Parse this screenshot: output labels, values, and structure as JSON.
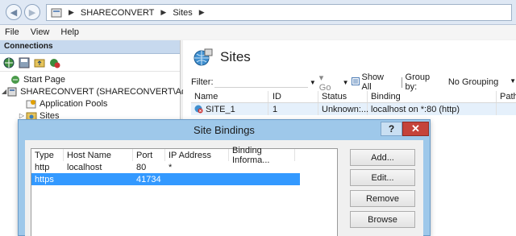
{
  "address": {
    "crumbs": [
      "SHARECONVERT",
      "Sites"
    ],
    "separator": "▶"
  },
  "menu": [
    "File",
    "View",
    "Help"
  ],
  "connections": {
    "header": "Connections",
    "tree": [
      {
        "label": "Start Page",
        "expander": ""
      },
      {
        "label": "SHARECONVERT (SHARECONVERT\\Administ",
        "expander": "◢"
      },
      {
        "label": "Application Pools",
        "expander": ""
      },
      {
        "label": "Sites",
        "expander": "▷"
      }
    ]
  },
  "sites": {
    "title": "Sites",
    "filter_label": "Filter:",
    "go_label": "Go",
    "show_all_label": "Show All",
    "group_by_label": "Group by:",
    "group_by_value": "No Grouping",
    "columns": [
      "Name",
      "ID",
      "Status",
      "Binding",
      "Path"
    ],
    "rows": [
      {
        "name": "SITE_1",
        "id": "1",
        "status": "Unknown:...",
        "binding": "localhost on *:80 (http)",
        "path": ""
      }
    ]
  },
  "dialog": {
    "title": "Site Bindings",
    "help_label": "?",
    "close_label": "✕",
    "columns": [
      "Type",
      "Host Name",
      "Port",
      "IP Address",
      "Binding Informa..."
    ],
    "rows": [
      {
        "type": "http",
        "host": "localhost",
        "port": "80",
        "ip": "*",
        "info": ""
      },
      {
        "type": "https",
        "host": "",
        "port": "41734",
        "ip": "",
        "info": ""
      }
    ],
    "buttons": {
      "add": "Add...",
      "edit": "Edit...",
      "remove": "Remove",
      "browse": "Browse"
    }
  }
}
